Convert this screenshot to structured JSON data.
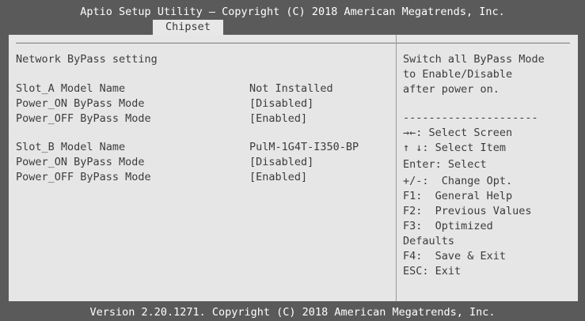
{
  "header": {
    "title": "Aptio Setup Utility – Copyright (C) 2018 American Megatrends, Inc.",
    "tab": "Chipset"
  },
  "main": {
    "section_title": "Network ByPass setting",
    "slot_a": {
      "model_label": "Slot_A Model Name",
      "model_value": "Not Installed",
      "power_on_label": "Power_ON ByPass Mode",
      "power_on_value": "[Disabled]",
      "power_off_label": "Power_OFF ByPass Mode",
      "power_off_value": "[Enabled]"
    },
    "slot_b": {
      "model_label": "Slot_B Model Name",
      "model_value": "PulM-1G4T-I350-BP",
      "power_on_label": "Power_ON ByPass Mode",
      "power_on_value": "[Disabled]",
      "power_off_label": "Power_OFF ByPass Mode",
      "power_off_value": "[Enabled]"
    }
  },
  "help": {
    "description": [
      "Switch all ByPass Mode",
      "to Enable/Disable",
      "after power on."
    ],
    "separator": "---------------------",
    "keys": [
      "→←: Select Screen",
      "↑ ↓: Select Item",
      "Enter: Select",
      "+/-:  Change Opt.",
      "F1:  General Help",
      "F2:  Previous Values",
      "F3:  Optimized",
      "Defaults",
      "F4:  Save & Exit",
      "ESC: Exit"
    ]
  },
  "footer": {
    "text": "Version 2.20.1271. Copyright (C) 2018 American Megatrends, Inc."
  }
}
